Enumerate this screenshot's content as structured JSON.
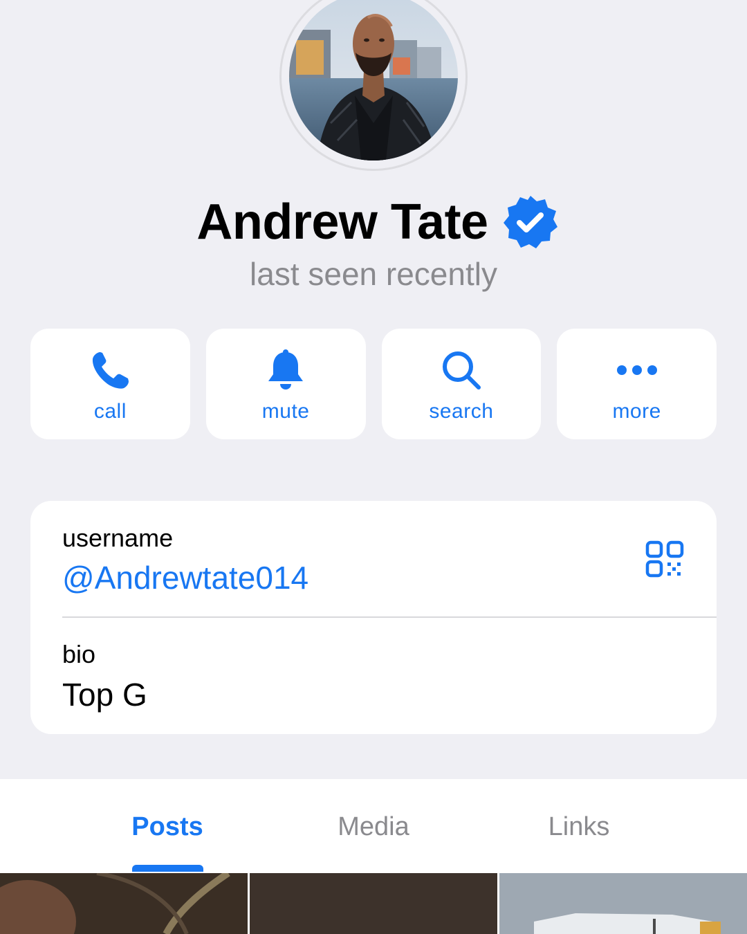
{
  "profile": {
    "name": "Andrew Tate",
    "status": "last seen recently",
    "verified": true,
    "avatar_icon": "profile-photo"
  },
  "actions": [
    {
      "label": "call",
      "icon": "phone-icon"
    },
    {
      "label": "mute",
      "icon": "bell-icon"
    },
    {
      "label": "search",
      "icon": "search-icon"
    },
    {
      "label": "more",
      "icon": "ellipsis-icon"
    }
  ],
  "info": {
    "username_label": "username",
    "username_value": "@Andrewtate014",
    "bio_label": "bio",
    "bio_value": "Top G",
    "qr_icon": "qr-code-icon"
  },
  "tabs": [
    {
      "label": "Posts",
      "active": true
    },
    {
      "label": "Media",
      "active": false
    },
    {
      "label": "Links",
      "active": false
    }
  ],
  "colors": {
    "accent": "#1877f2",
    "background": "#efeff4",
    "secondary_text": "#8a8a8e",
    "card": "#ffffff"
  }
}
